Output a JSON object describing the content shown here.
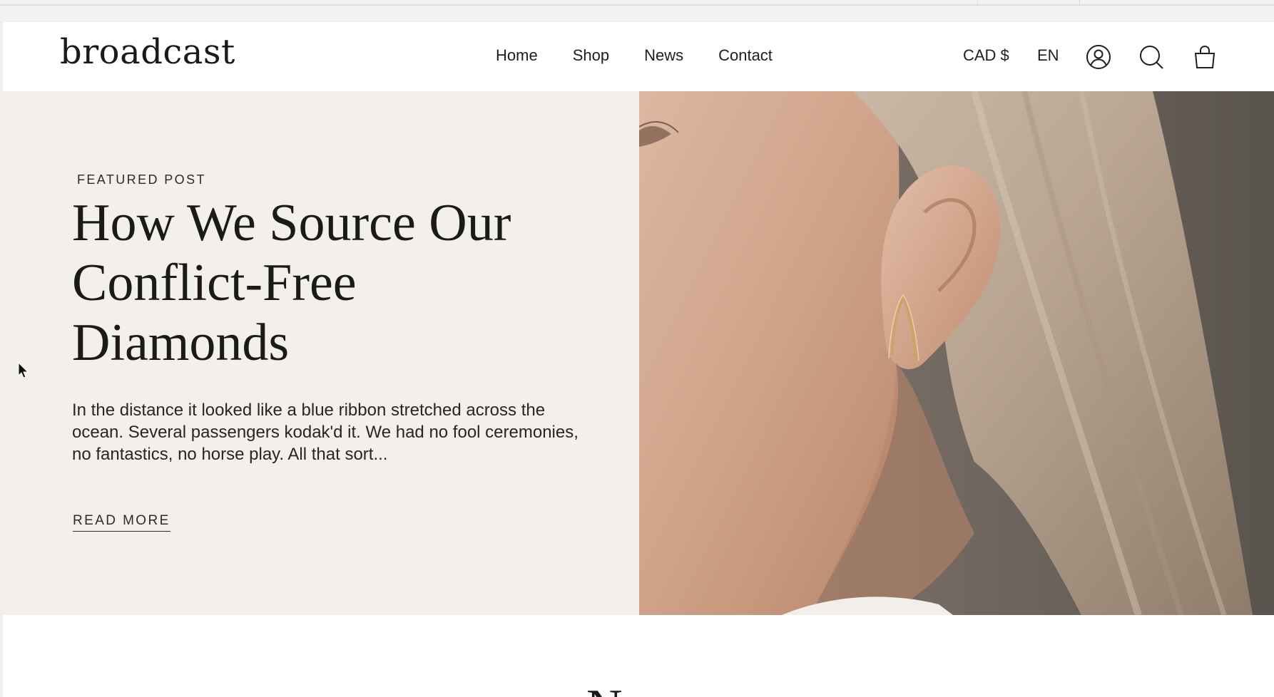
{
  "header": {
    "logo_text": "broadcast",
    "nav": [
      {
        "label": "Home"
      },
      {
        "label": "Shop"
      },
      {
        "label": "News"
      },
      {
        "label": "Contact"
      }
    ],
    "currency": "CAD $",
    "language": "EN",
    "icons": {
      "account": "account-icon",
      "search": "search-icon",
      "cart": "cart-icon"
    }
  },
  "hero": {
    "eyebrow": "FEATURED POST",
    "title": "How We Source Our Conflict-Free Diamonds",
    "excerpt": "In the distance it looked like a blue ribbon stretched across the ocean. Several passengers kodak'd it. We had no fool ceremonies, no fantastics, no horse play. All that sort...",
    "cta": "READ MORE",
    "image_alt": "Close-up of an ear wearing a gold ear cuff"
  },
  "next_section": {
    "heading_peek": "N"
  },
  "colors": {
    "hero_bg": "#f3f0ec",
    "text": "#1e1e1e",
    "page_bg": "#ffffff"
  }
}
